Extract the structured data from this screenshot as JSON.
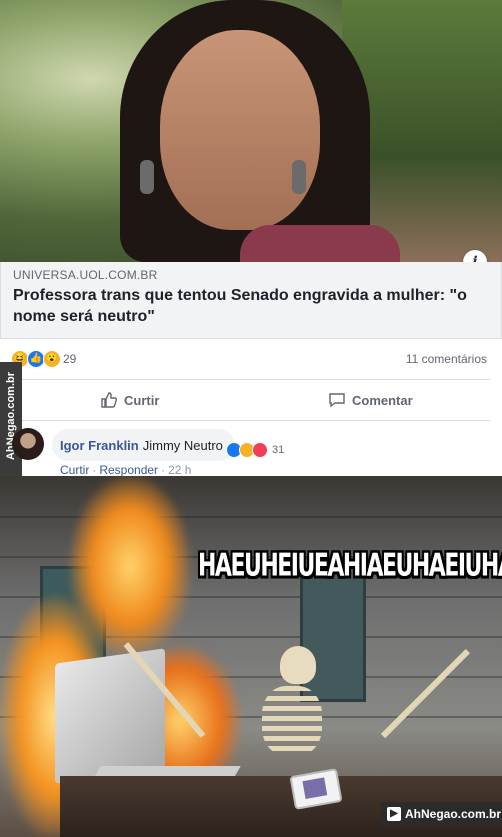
{
  "link_preview": {
    "domain": "UNIVERSA.UOL.COM.BR",
    "headline": "Professora trans que tentou Senado engravida a mulher: \"o nome será neutro\"",
    "info_icon": "info-icon"
  },
  "post_stats": {
    "reaction_icons": [
      "haha-icon",
      "like-icon",
      "wow-icon"
    ],
    "reaction_count": "29",
    "comments_count": "11 comentários"
  },
  "actions": {
    "like_label": "Curtir",
    "comment_label": "Comentar"
  },
  "comment": {
    "author": "Igor Franklin",
    "text": "Jimmy Neutro",
    "reaction_icons": [
      "like-icon",
      "haha-icon",
      "love-icon"
    ],
    "reaction_count": "31",
    "like_label": "Curtir",
    "reply_label": "Responder",
    "time": "22 h"
  },
  "watermark_side": "AhNegao.com.br",
  "meme": {
    "caption": "HAEUHEIUEAHIAEUHAEIUHAEIUEAH",
    "badge": "AhNegao.com.br"
  },
  "colors": {
    "link_blue": "#385898",
    "text_gray": "#606770",
    "like_blue": "#1877f2",
    "love_red": "#f33e58",
    "haha_yellow": "#f7b125"
  }
}
